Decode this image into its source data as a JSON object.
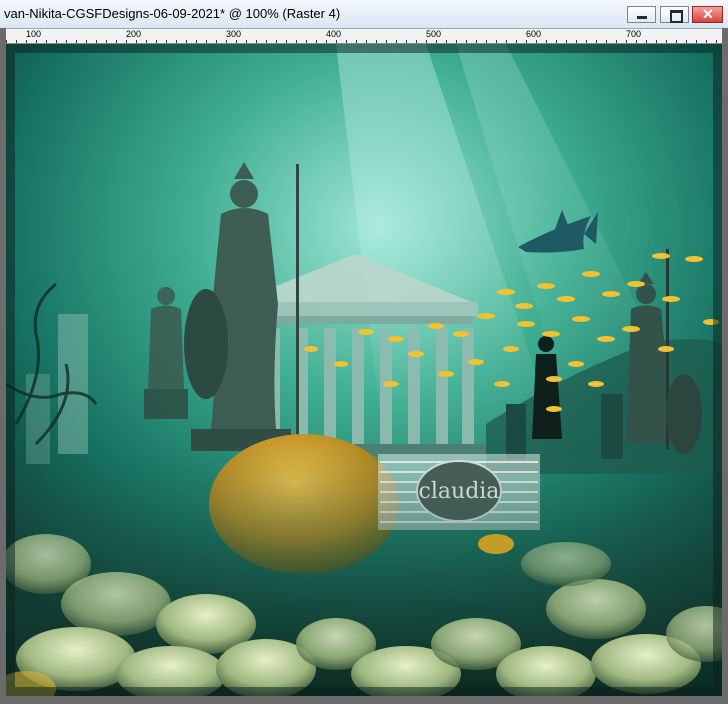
{
  "window": {
    "title": "van-Nikita-CGSFDesigns-06-09-2021* @ 100% (Raster 4)"
  },
  "buttons": {
    "minimize": "minimize-icon",
    "maximize": "maximize-icon",
    "close": "close-icon"
  },
  "ruler": {
    "labels": [
      "100",
      "200",
      "300",
      "400",
      "500",
      "600",
      "700"
    ]
  },
  "artwork": {
    "watermark": "claudia",
    "colors": {
      "sea_light": "#6fd0bb",
      "sea_mid": "#1e8a70",
      "sea_dark": "#0d3a31",
      "fish": "#f1c232"
    }
  }
}
